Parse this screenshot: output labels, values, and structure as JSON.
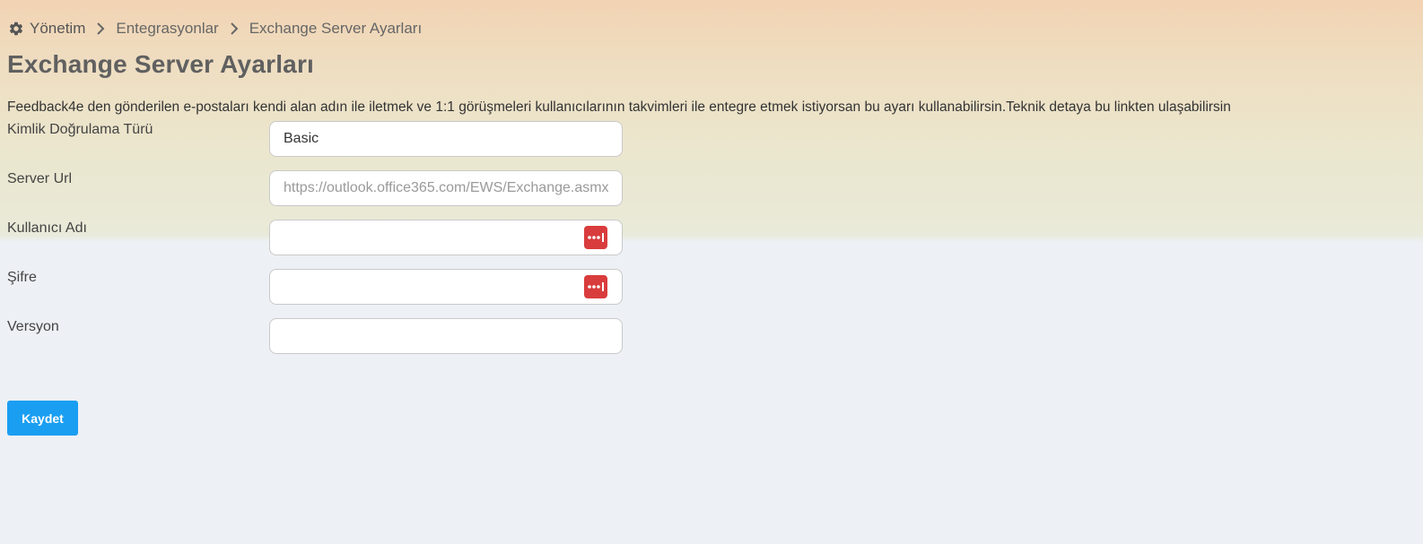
{
  "breadcrumb": {
    "home": "Yönetim",
    "level2": "Entegrasyonlar",
    "current": "Exchange Server Ayarları",
    "home_icon": "gear-icon",
    "separator_icon": "chevron-right-icon"
  },
  "page": {
    "title": "Exchange Server Ayarları",
    "description": "Feedback4e den gönderilen e-postaları kendi alan adın ile iletmek ve 1:1 görüşmeleri kullanıcılarının takvimleri ile entegre etmek istiyorsan bu ayarı kullanabilirsin.Teknik detaya bu linkten ulaşabilirsin"
  },
  "form": {
    "auth_type": {
      "label": "Kimlik Doğrulama Türü",
      "value": "Basic"
    },
    "server_url": {
      "label": "Server Url",
      "value": "",
      "placeholder": "https://outlook.office365.com/EWS/Exchange.asmx"
    },
    "username": {
      "label": "Kullanıcı Adı",
      "value": "",
      "icon": "password-manager-icon"
    },
    "password": {
      "label": "Şifre",
      "value": "",
      "icon": "password-manager-icon"
    },
    "version": {
      "label": "Versyon",
      "value": ""
    }
  },
  "actions": {
    "save_label": "Kaydet"
  },
  "colors": {
    "accent": "#1a9ef2",
    "password_icon": "#d93c3c",
    "title": "#606060"
  }
}
